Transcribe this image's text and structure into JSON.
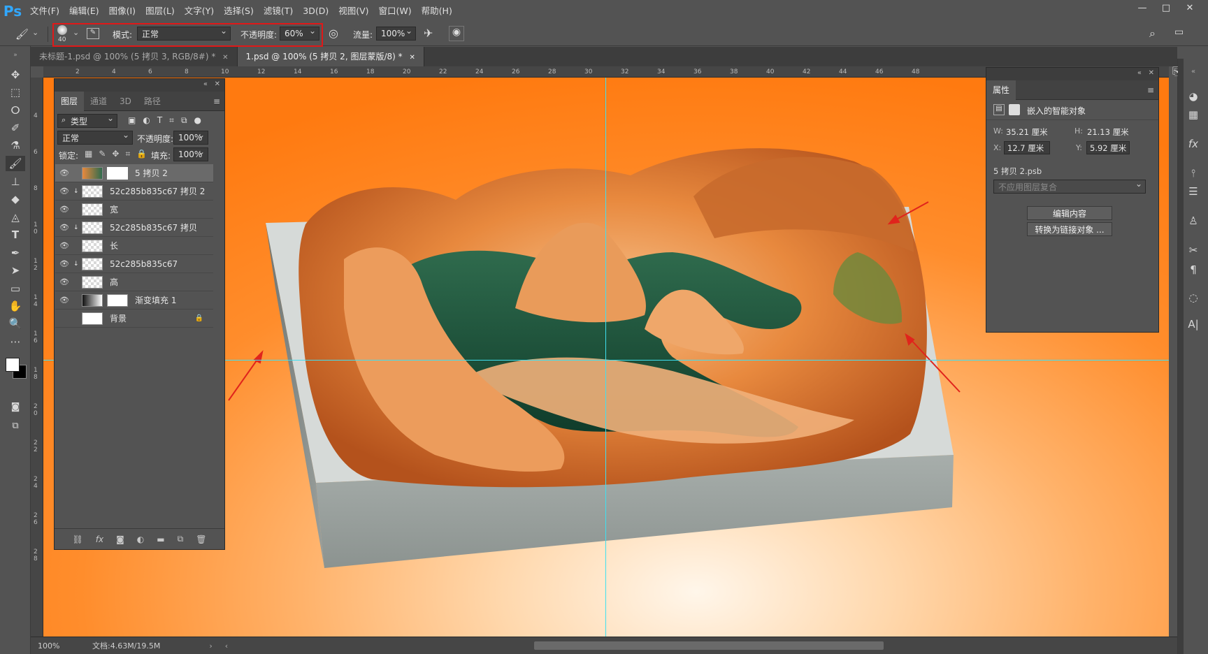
{
  "app": {
    "logo": "Ps"
  },
  "menu": [
    "文件(F)",
    "编辑(E)",
    "图像(I)",
    "图层(L)",
    "文字(Y)",
    "选择(S)",
    "滤镜(T)",
    "3D(D)",
    "视图(V)",
    "窗口(W)",
    "帮助(H)"
  ],
  "window_controls": {
    "minimize": "—",
    "maximize": "□",
    "close": "✕"
  },
  "options": {
    "brush_size": "40",
    "mode_label": "模式:",
    "mode_value": "正常",
    "opacity_label": "不透明度:",
    "opacity_value": "60%",
    "flow_label": "流量:",
    "flow_value": "100%"
  },
  "tabs": [
    {
      "label": "未标题-1.psd @ 100% (5 拷贝 3, RGB/8#) *",
      "close": "✕",
      "active": false
    },
    {
      "label": "1.psd @ 100% (5 拷贝 2, 图层蒙版/8) *",
      "close": "✕",
      "active": true
    }
  ],
  "ruler_h": [
    "2",
    "4",
    "6",
    "8",
    "10",
    "12",
    "14",
    "16",
    "18",
    "20",
    "22",
    "24",
    "26",
    "28",
    "30",
    "32",
    "34",
    "36",
    "38",
    "40",
    "42",
    "44",
    "46",
    "48"
  ],
  "ruler_v": [
    "4",
    "6",
    "8",
    "1\n0",
    "1\n2",
    "1\n4",
    "1\n6",
    "1\n8",
    "2\n0",
    "2\n2",
    "2\n4",
    "2\n6",
    "2\n8"
  ],
  "layers_panel": {
    "tabs": [
      "图层",
      "通道",
      "3D",
      "路径"
    ],
    "filter_kind": "类型",
    "blend_mode": "正常",
    "opacity_label": "不透明度:",
    "opacity_value": "100%",
    "lock_label": "锁定:",
    "fill_label": "填充:",
    "fill_value": "100%",
    "layers": [
      {
        "name": "5 拷贝 2",
        "visible": true,
        "selected": true
      },
      {
        "name": "52c285b835c67 拷贝 2",
        "visible": true,
        "selected": false
      },
      {
        "name": "宽",
        "visible": true,
        "selected": false
      },
      {
        "name": "52c285b835c67 拷贝",
        "visible": true,
        "selected": false
      },
      {
        "name": "长",
        "visible": true,
        "selected": false
      },
      {
        "name": "52c285b835c67",
        "visible": true,
        "selected": false
      },
      {
        "name": "高",
        "visible": true,
        "selected": false
      },
      {
        "name": "渐变填充 1",
        "visible": true,
        "selected": false
      },
      {
        "name": "背景",
        "visible": false,
        "selected": false
      }
    ],
    "footer_icons": [
      "link-icon",
      "fx-icon",
      "mask-icon",
      "adjustment-icon",
      "folder-icon",
      "new-layer-icon",
      "trash-icon"
    ]
  },
  "properties_panel": {
    "title": "属性",
    "type_label": "嵌入的智能对象",
    "w_label": "W:",
    "w_value": "35.21 厘米",
    "h_label": "H:",
    "h_value": "21.13 厘米",
    "x_label": "X:",
    "x_value": "12.7 厘米",
    "y_label": "Y:",
    "y_value": "5.92 厘米",
    "source": "5 拷贝 2.psb",
    "comp": "不应用图层复合",
    "edit_button": "编辑内容",
    "convert_button": "转换为链接对象 ..."
  },
  "status": {
    "zoom": "100%",
    "doc": "文档:4.63M/19.5M"
  },
  "colors": {
    "accent": "#31a8ff",
    "guide": "#3fe0f0",
    "outline": "#e01818",
    "canvas_bg": "#ff7a10"
  }
}
